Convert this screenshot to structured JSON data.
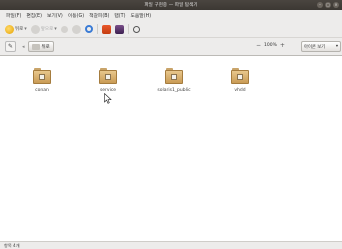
{
  "window": {
    "title": "파일 구현중 — 파일 탐색기",
    "controls": [
      "–",
      "□",
      "×"
    ]
  },
  "menubar": {
    "items": [
      "파일(F)",
      "편집(E)",
      "보기(V)",
      "이동(G)",
      "책갈피(B)",
      "탭(T)",
      "도움말(H)"
    ]
  },
  "toolbar": {
    "back_label": "뒤로",
    "forward_label": "앞으로",
    "icons": [
      "back-icon",
      "forward-icon",
      "up-icon",
      "stop-icon",
      "reload-icon",
      "home-icon",
      "computer-icon",
      "search-icon"
    ]
  },
  "location": {
    "edit_icon": "pencil-icon",
    "crumb_label": "뒤로"
  },
  "zoom": {
    "out_symbol": "−",
    "value": "100%",
    "in_symbol": "+"
  },
  "view": {
    "selected": "아이콘 보기",
    "arrow": "▾"
  },
  "files": [
    {
      "name": "conan",
      "icon": "folder-icon"
    },
    {
      "name": "service",
      "icon": "folder-icon"
    },
    {
      "name": "solaris1_public",
      "icon": "folder-icon"
    },
    {
      "name": "vhdd",
      "icon": "folder-icon"
    }
  ],
  "status": {
    "text": "항목 4개"
  },
  "colors": {
    "titlebar": "#3c3833",
    "folder": "#d9b47a",
    "chrome": "#edeceb"
  }
}
